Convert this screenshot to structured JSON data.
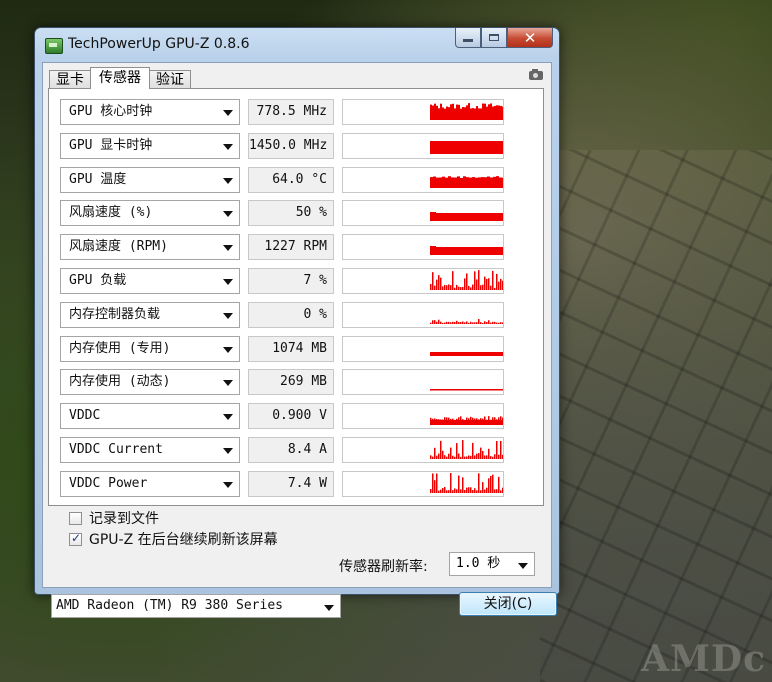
{
  "window": {
    "title": "TechPowerUp GPU-Z 0.8.6",
    "close_glyph": "✕"
  },
  "tabs": [
    {
      "label": "显卡",
      "active": false
    },
    {
      "label": "传感器",
      "active": true
    },
    {
      "label": "验证",
      "active": false
    }
  ],
  "sensors": [
    {
      "name": "GPU 核心时钟",
      "value": "778.5 MHz",
      "graph": "clock"
    },
    {
      "name": "GPU 显卡时钟",
      "value": "1450.0 MHz",
      "graph": "full"
    },
    {
      "name": "GPU 温度",
      "value": "64.0 °C",
      "graph": "temp"
    },
    {
      "name": "风扇速度 (%)",
      "value": "50 %",
      "graph": "fan"
    },
    {
      "name": "风扇速度 (RPM)",
      "value": "1227 RPM",
      "graph": "fan"
    },
    {
      "name": "GPU 负载",
      "value": "7 %",
      "graph": "spiky"
    },
    {
      "name": "内存控制器负载",
      "value": "0 %",
      "graph": "low"
    },
    {
      "name": "内存使用 (专用)",
      "value": "1074 MB",
      "graph": "memded"
    },
    {
      "name": "内存使用 (动态)",
      "value": "269 MB",
      "graph": "memdyn"
    },
    {
      "name": "VDDC",
      "value": "0.900 V",
      "graph": "vddc"
    },
    {
      "name": "VDDC Current",
      "value": "8.4 A",
      "graph": "spiky2"
    },
    {
      "name": "VDDC Power",
      "value": "7.4 W",
      "graph": "spiky2"
    }
  ],
  "options": {
    "log_to_file": {
      "label": "记录到文件",
      "checked": false
    },
    "continue_refresh": {
      "label": "GPU-Z 在后台继续刷新该屏幕",
      "checked": true
    }
  },
  "refresh_rate": {
    "label": "传感器刷新率:",
    "value": "1.0 秒"
  },
  "gpu_select": {
    "value": "AMD Radeon (TM) R9 380 Series"
  },
  "close_button": {
    "label": "关闭(C)"
  },
  "colors": {
    "graph": "#ee0000"
  },
  "wallpaper": {
    "text": "AMDc"
  }
}
